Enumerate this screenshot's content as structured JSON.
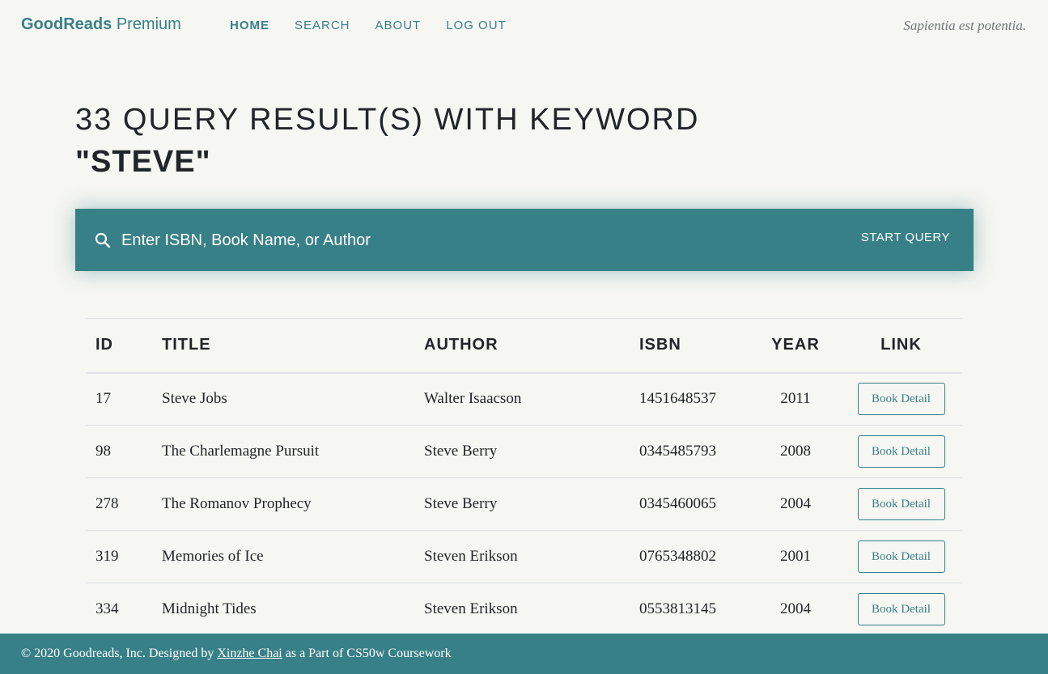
{
  "nav": {
    "brand_bold": "GoodReads",
    "brand_light": "Premium",
    "links": [
      {
        "label": "HOME"
      },
      {
        "label": "SEARCH"
      },
      {
        "label": "ABOUT"
      },
      {
        "label": "LOG OUT"
      }
    ],
    "motto": "Sapientia est potentia."
  },
  "heading": {
    "line1": "33 QUERY RESULT(S) WITH KEYWORD",
    "keyword": "\"STEVE\""
  },
  "search": {
    "placeholder": "Enter ISBN, Book Name, or Author",
    "button_label": "START QUERY"
  },
  "table": {
    "headers": [
      "ID",
      "TITLE",
      "AUTHOR",
      "ISBN",
      "YEAR",
      "LINK"
    ],
    "rows": [
      {
        "id": "17",
        "title": "Steve Jobs",
        "author": "Walter Isaacson",
        "isbn": "1451648537",
        "year": "2011",
        "link": "Book Detail"
      },
      {
        "id": "98",
        "title": "The Charlemagne Pursuit",
        "author": "Steve Berry",
        "isbn": "0345485793",
        "year": "2008",
        "link": "Book Detail"
      },
      {
        "id": "278",
        "title": "The Romanov Prophecy",
        "author": "Steve Berry",
        "isbn": "0345460065",
        "year": "2004",
        "link": "Book Detail"
      },
      {
        "id": "319",
        "title": "Memories of Ice",
        "author": "Steven Erikson",
        "isbn": "0765348802",
        "year": "2001",
        "link": "Book Detail"
      },
      {
        "id": "334",
        "title": "Midnight Tides",
        "author": "Steven Erikson",
        "isbn": "0553813145",
        "year": "2004",
        "link": "Book Detail"
      }
    ]
  },
  "footer": {
    "prefix": "© 2020 Goodreads, Inc. Designed by",
    "author_link": "Xinzhe Chai",
    "suffix": "as a Part of CS50w Coursework"
  },
  "colors": {
    "accent": "#388087",
    "background": "#f6f6f2",
    "text": "#212529"
  }
}
